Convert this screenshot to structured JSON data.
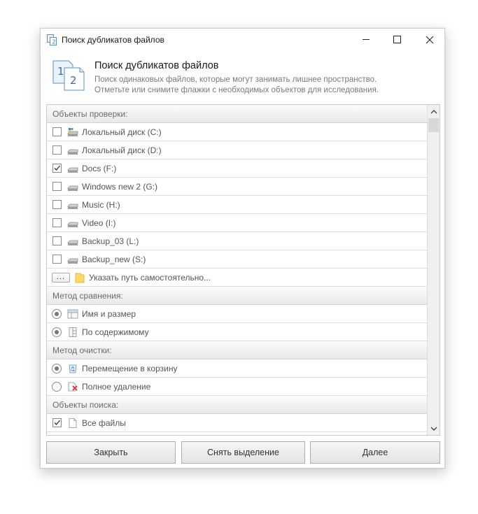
{
  "window": {
    "title": "Поиск дубликатов файлов"
  },
  "header": {
    "title": "Поиск дубликатов файлов",
    "desc_line1": "Поиск одинаковых файлов, которые могут занимать лишнее пространство.",
    "desc_line2": "Отметьте или снимите флажки с необходимых объектов для исследования."
  },
  "scan_objects": {
    "heading": "Объекты проверки:",
    "drives": [
      {
        "label": "Локальный диск (C:)",
        "checked": false,
        "icon": "system-drive-icon"
      },
      {
        "label": "Локальный диск (D:)",
        "checked": false,
        "icon": "drive-icon"
      },
      {
        "label": "Docs (F:)",
        "checked": true,
        "icon": "drive-icon"
      },
      {
        "label": "Windows new 2 (G:)",
        "checked": false,
        "icon": "drive-icon"
      },
      {
        "label": "Music (H:)",
        "checked": false,
        "icon": "drive-icon"
      },
      {
        "label": "Video (I:)",
        "checked": false,
        "icon": "drive-icon"
      },
      {
        "label": "Backup_03 (L:)",
        "checked": false,
        "icon": "drive-icon"
      },
      {
        "label": "Backup_new (S:)",
        "checked": false,
        "icon": "drive-icon"
      }
    ],
    "custom_path": {
      "button": "...",
      "label": "Указать путь самостоятельно..."
    }
  },
  "compare_method": {
    "heading": "Метод сравнения:",
    "options": [
      {
        "label": "Имя и размер",
        "selected": true,
        "icon": "table-icon"
      },
      {
        "label": "По содержимому",
        "selected": true,
        "icon": "content-icon"
      }
    ]
  },
  "cleanup_method": {
    "heading": "Метод очистки:",
    "options": [
      {
        "label": "Перемещение в корзину",
        "selected": true,
        "icon": "recycle-bin-icon"
      },
      {
        "label": "Полное удаление",
        "selected": false,
        "icon": "delete-file-icon"
      }
    ]
  },
  "search_objects": {
    "heading": "Объекты поиска:",
    "options": [
      {
        "label": "Все файлы",
        "checked": true,
        "icon": "file-icon"
      }
    ]
  },
  "buttons": {
    "close": "Закрыть",
    "deselect": "Снять выделение",
    "next": "Далее"
  },
  "colors": {
    "accent_blue": "#3a86c8",
    "text_gray": "#555555",
    "group_text": "#6b6b6b"
  }
}
